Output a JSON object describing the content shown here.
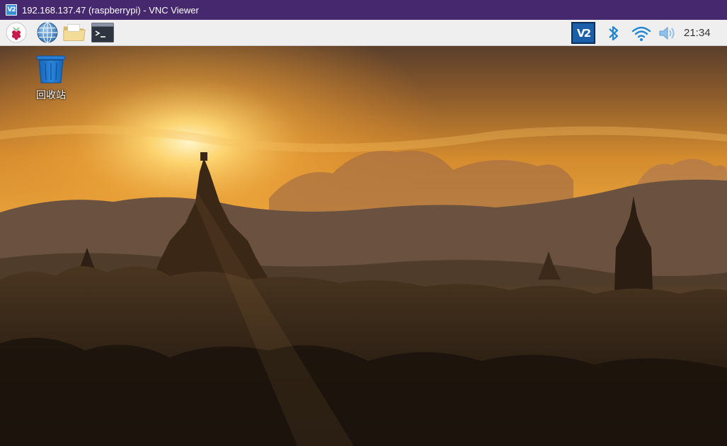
{
  "window": {
    "title": "192.168.137.47 (raspberrypi) - VNC Viewer",
    "app_icon_text": "V2"
  },
  "taskbar": {
    "launchers": [
      {
        "name": "raspberry-menu",
        "icon": "raspberry-icon"
      },
      {
        "name": "web-browser",
        "icon": "globe-icon"
      },
      {
        "name": "file-manager",
        "icon": "folder-icon"
      },
      {
        "name": "terminal",
        "icon": "terminal-icon"
      }
    ],
    "tray": [
      {
        "name": "vnc-server",
        "icon": "vnc-icon",
        "text": "V2"
      },
      {
        "name": "bluetooth",
        "icon": "bluetooth-icon"
      },
      {
        "name": "wifi",
        "icon": "wifi-icon"
      },
      {
        "name": "volume",
        "icon": "volume-icon"
      }
    ],
    "clock": "21:34",
    "accent": "#1a5fa8"
  },
  "desktop": {
    "icons": [
      {
        "label": "回收站",
        "icon": "trash-icon"
      }
    ],
    "wallpaper": "sunset-temples-silhouette"
  }
}
